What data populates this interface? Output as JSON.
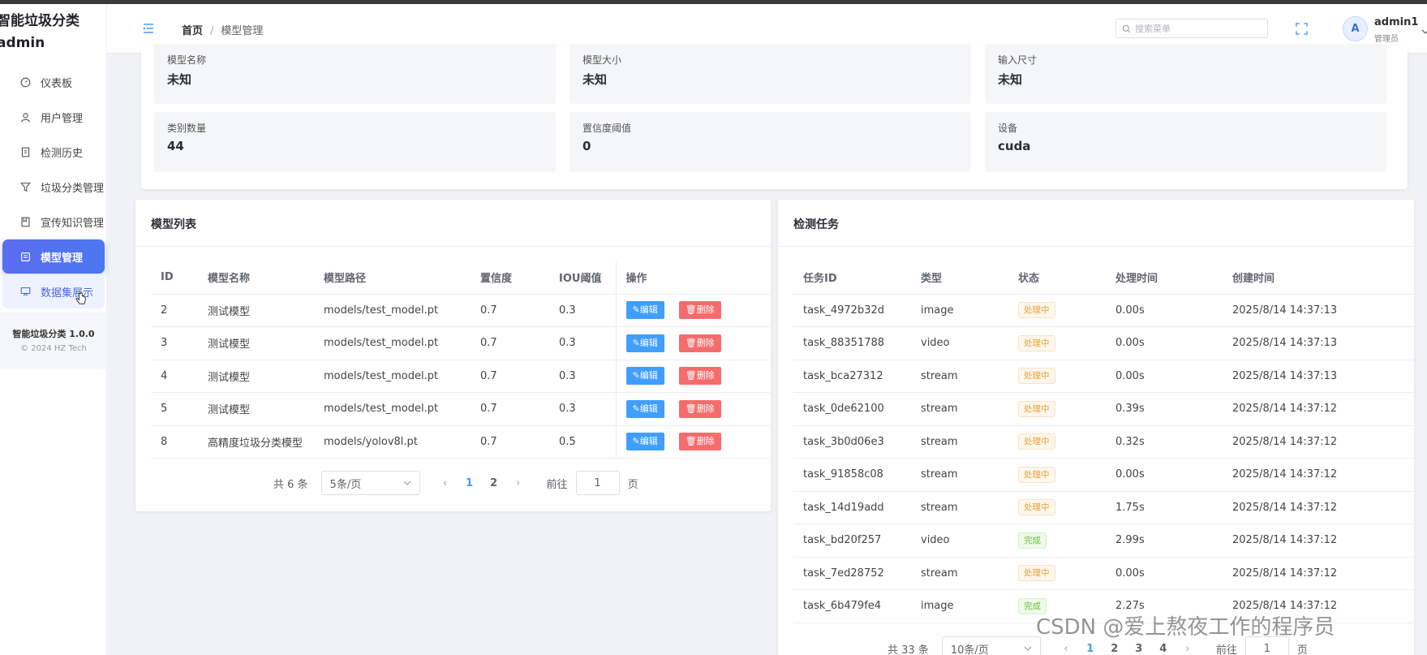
{
  "app": {
    "brand": "智能垃圾分类\nadmin"
  },
  "sidebar": {
    "items": [
      {
        "label": "仪表板",
        "icon": "dashboard-icon"
      },
      {
        "label": "用户管理",
        "icon": "user-icon"
      },
      {
        "label": "检测历史",
        "icon": "document-icon"
      },
      {
        "label": "垃圾分类管理",
        "icon": "filter-icon"
      },
      {
        "label": "宣传知识管理",
        "icon": "notebook-icon"
      },
      {
        "label": "模型管理",
        "icon": "model-icon"
      },
      {
        "label": "数据集展示",
        "icon": "presentation-icon"
      }
    ],
    "version": "智能垃圾分类 1.0.0",
    "copyright": "© 2024 HZ Tech"
  },
  "header": {
    "breadcrumb": [
      "首页",
      "/",
      "模型管理"
    ],
    "search_placeholder": "搜索菜单",
    "avatar_letter": "A",
    "username": "admin1",
    "role": "管理员"
  },
  "model_info": [
    {
      "label": "模型名称",
      "value": "未知"
    },
    {
      "label": "模型大小",
      "value": "未知"
    },
    {
      "label": "输入尺寸",
      "value": "未知"
    },
    {
      "label": "类别数量",
      "value": "44"
    },
    {
      "label": "置信度阈值",
      "value": "0"
    },
    {
      "label": "设备",
      "value": "cuda"
    }
  ],
  "model_list": {
    "title": "模型列表",
    "columns": [
      "ID",
      "模型名称",
      "模型路径",
      "置信度",
      "IOU阈值",
      "操作"
    ],
    "rows": [
      [
        "2",
        "测试模型",
        "models/test_model.pt",
        "0.7",
        "0.3"
      ],
      [
        "3",
        "测试模型",
        "models/test_model.pt",
        "0.7",
        "0.3"
      ],
      [
        "4",
        "测试模型",
        "models/test_model.pt",
        "0.7",
        "0.3"
      ],
      [
        "5",
        "测试模型",
        "models/test_model.pt",
        "0.7",
        "0.3"
      ],
      [
        "8",
        "高精度垃圾分类模型",
        "models/yolov8l.pt",
        "0.7",
        "0.5"
      ]
    ],
    "edit_label": "编辑",
    "delete_label": "删除",
    "pager": {
      "total": "共 6 条",
      "size": "5条/页",
      "pages": [
        "1",
        "2"
      ],
      "goto": "前往",
      "goto_value": "1",
      "page_unit": "页"
    }
  },
  "tasks": {
    "title": "检测任务",
    "columns": [
      "任务ID",
      "类型",
      "状态",
      "处理时间",
      "创建时间"
    ],
    "rows": [
      [
        "task_4972b32d",
        "image",
        "处理中",
        "0.00s",
        "2025/8/14 14:37:13"
      ],
      [
        "task_88351788",
        "video",
        "处理中",
        "0.00s",
        "2025/8/14 14:37:13"
      ],
      [
        "task_bca27312",
        "stream",
        "处理中",
        "0.00s",
        "2025/8/14 14:37:13"
      ],
      [
        "task_0de62100",
        "stream",
        "处理中",
        "0.39s",
        "2025/8/14 14:37:12"
      ],
      [
        "task_3b0d06e3",
        "stream",
        "处理中",
        "0.32s",
        "2025/8/14 14:37:12"
      ],
      [
        "task_91858c08",
        "stream",
        "处理中",
        "0.00s",
        "2025/8/14 14:37:12"
      ],
      [
        "task_14d19add",
        "stream",
        "处理中",
        "1.75s",
        "2025/8/14 14:37:12"
      ],
      [
        "task_bd20f257",
        "video",
        "完成",
        "2.99s",
        "2025/8/14 14:37:12"
      ],
      [
        "task_7ed28752",
        "stream",
        "处理中",
        "0.00s",
        "2025/8/14 14:37:12"
      ],
      [
        "task_6b479fe4",
        "image",
        "完成",
        "2.27s",
        "2025/8/14 14:37:12"
      ]
    ],
    "pager": {
      "total": "共 33 条",
      "size": "10条/页",
      "pages": [
        "1",
        "2",
        "3",
        "4"
      ],
      "goto": "前往",
      "goto_value": "1",
      "page_unit": "页"
    }
  },
  "watermark": "CSDN @爱上熬夜工作的程序员",
  "colors": {
    "accent": "#409eff",
    "active_menu": "#5b6cf0",
    "danger": "#f56c6c",
    "processing": "#e6a23c",
    "done": "#67c23a"
  }
}
